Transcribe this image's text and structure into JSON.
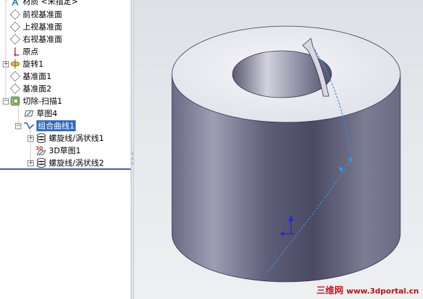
{
  "feature_tree": {
    "items": [
      {
        "label": "材质 <未指定>"
      },
      {
        "label": "前视基准面"
      },
      {
        "label": "上视基准面"
      },
      {
        "label": "右视基准面"
      },
      {
        "label": "原点"
      },
      {
        "label": "旋转1"
      },
      {
        "label": "基准面1"
      },
      {
        "label": "基准面2"
      },
      {
        "label": "切除-扫描1"
      },
      {
        "label": "草图4"
      },
      {
        "label": "组合曲线1"
      },
      {
        "label": "螺旋线/涡状线1"
      },
      {
        "label": "3D草图1"
      },
      {
        "label": "螺旋线/涡状线2"
      }
    ],
    "sketch3d_icon_text": "3D"
  },
  "viewport": {
    "model_colors": {
      "body_dark": "#5a5a75",
      "body_light": "#b9b9cc",
      "top_face": "#ececf2",
      "curve": "#3d8fd9"
    }
  },
  "watermark": {
    "cn": "三维网",
    "url": "www.3dportal.cn"
  }
}
